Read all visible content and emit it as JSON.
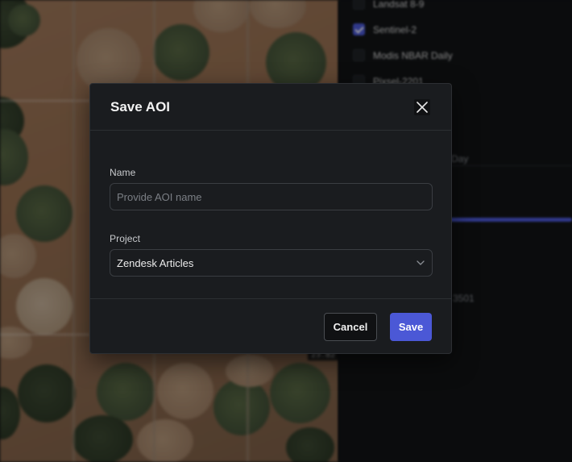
{
  "background": {
    "map_scale_label": "23.82",
    "panel": {
      "layers": [
        {
          "label": "Landsat 8-9",
          "checked": false
        },
        {
          "label": "Sentinel-2",
          "checked": true
        },
        {
          "label": "Modis NBAR Daily",
          "checked": false
        },
        {
          "label": "Pixsel-2201",
          "checked": false
        }
      ],
      "day_text": "Day",
      "code_text": "3501"
    }
  },
  "modal": {
    "title": "Save AOI",
    "name_label": "Name",
    "name_placeholder": "Provide AOI name",
    "name_value": "",
    "project_label": "Project",
    "project_value": "Zendesk Articles",
    "cancel_label": "Cancel",
    "save_label": "Save",
    "accent_color": "#4b58d6"
  }
}
